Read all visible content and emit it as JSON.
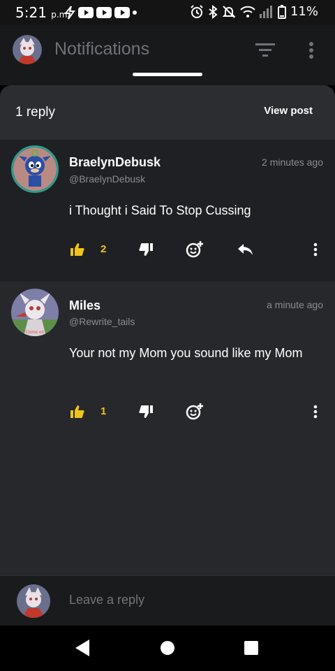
{
  "status": {
    "time": "5:21",
    "ampm": "p.m.",
    "battery": "11%",
    "icons": [
      "flash-icon",
      "youtube-icon",
      "youtube-icon",
      "youtube-icon",
      "dot-icon",
      "alarm-icon",
      "bluetooth-icon",
      "mute-icon",
      "wifi-icon",
      "signal-icon",
      "battery-icon"
    ]
  },
  "app_bar": {
    "title": "Notifications",
    "icons": [
      "filter-icon",
      "more-vert-icon"
    ]
  },
  "sheet": {
    "title": "1 reply",
    "view_post": "View post"
  },
  "comments": [
    {
      "author": "BraelynDebusk",
      "handle": "@BraelynDebusk",
      "time": "2 minutes ago",
      "text": "i Thought i Said To Stop Cussing",
      "likes": "2"
    },
    {
      "author": "Miles",
      "handle": "@Rewrite_tails",
      "time": "a minute ago",
      "text": "Your not my Mom you sound like my Mom",
      "likes": "1"
    }
  ],
  "reply_bar": {
    "placeholder": "Leave a reply"
  },
  "colors": {
    "accent": "#f0c419",
    "background": "#1f2023",
    "muted_text": "#8a8d92"
  }
}
